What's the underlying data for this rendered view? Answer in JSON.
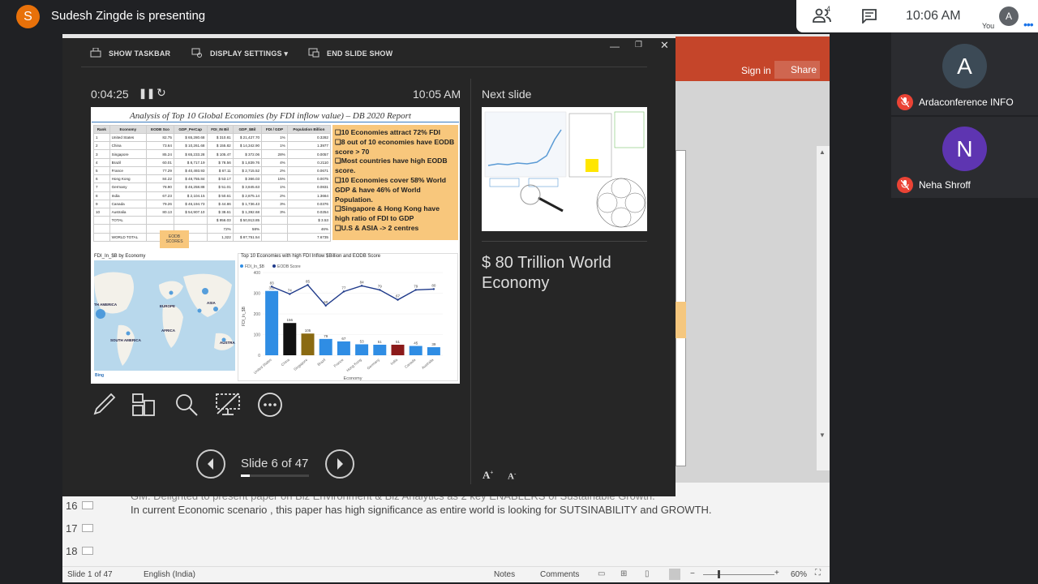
{
  "meet": {
    "presenter_initial": "S",
    "presenter_text": "Sudesh Zingde is presenting",
    "people_count": "4",
    "clock": "10:06 AM",
    "you_initial": "A",
    "you_label": "You",
    "participants": [
      {
        "initial": "A",
        "name": "Ardaconference INFO",
        "color": "#3c4a56"
      },
      {
        "initial": "N",
        "name": "Neha Shroff",
        "color": "#5e35b1"
      }
    ]
  },
  "ppt": {
    "sign_in": "Sign in",
    "share": "Share",
    "thumbs": [
      "16",
      "17",
      "18"
    ],
    "notes_line1": "GM. Delighted to present paper on Biz Environment & Biz Analytics as 2 key ENABLERS of Sustainable Growth.",
    "notes_line2": "In current Economic scenario , this paper has high significance as entire world is looking for SUTSINABILITY and GROWTH.",
    "status": {
      "slide": "Slide 1 of 47",
      "language": "English (India)",
      "notes": "Notes",
      "comments": "Comments",
      "zoom": "60%"
    }
  },
  "presenter_view": {
    "menu": {
      "taskbar": "SHOW TASKBAR",
      "display": "DISPLAY SETTINGS ▾",
      "end": "END SLIDE SHOW"
    },
    "timer": "0:04:25",
    "time": "10:05 AM",
    "next_slide_label": "Next slide",
    "slide_counter": "Slide 6 of 47",
    "progress": 0.128,
    "notes": "$ 80 Trillion World Economy"
  },
  "slide": {
    "title": "Analysis of Top 10 Global Economies (by FDI inflow value) – DB 2020 Report",
    "table_headers": [
      "Rank",
      "Economy",
      "EODB Sco",
      "GDP_PerCap",
      "FDI_IN Bil",
      "GDP_$Bil",
      "FDI / GDP",
      "Population Billion"
    ],
    "rows": [
      [
        "1",
        "United States",
        "82.75",
        "$ 65,280.68",
        "$ 310.81",
        "$ 21,427.70",
        "1%",
        "0.3282"
      ],
      [
        "2",
        "China",
        "73.64",
        "$ 10,261.68",
        "$ 155.82",
        "$ 14,342.90",
        "1%",
        "1.3977"
      ],
      [
        "3",
        "Singapore",
        "85.24",
        "$ 65,233.28",
        "$ 105.47",
        "$ 372.06",
        "28%",
        "0.0057"
      ],
      [
        "4",
        "Brazil",
        "60.01",
        "$ 8,717.19",
        "$ 78.56",
        "$ 1,839.76",
        "4%",
        "0.2110"
      ],
      [
        "5",
        "France",
        "77.29",
        "$ 40,493.93",
        "$ 67.11",
        "$ 2,715.52",
        "2%",
        "0.0671"
      ],
      [
        "6",
        "Hong Kong",
        "84.22",
        "$ 48,755.84",
        "$ 53.17",
        "$ 366.03",
        "15%",
        "0.0075"
      ],
      [
        "7",
        "Germany",
        "78.90",
        "$ 46,258.88",
        "$ 51.01",
        "$ 3,845.63",
        "1%",
        "0.0831"
      ],
      [
        "8",
        "India",
        "67.23",
        "$ 2,104.15",
        "$ 50.61",
        "$ 2,875.14",
        "2%",
        "1.3664"
      ],
      [
        "9",
        "Canada",
        "79.26",
        "$ 46,194.73",
        "$ 44.86",
        "$ 1,736.43",
        "3%",
        "0.0376"
      ],
      [
        "10",
        "Australia",
        "80.13",
        "$ 54,907.10",
        "$ 38.61",
        "$ 1,392.68",
        "3%",
        "0.0254"
      ]
    ],
    "total_row": [
      "",
      "TOTAL",
      "",
      "",
      "$ 956.03",
      "$ 50,913.85",
      "",
      "$ 3.53"
    ],
    "pct_row": [
      "",
      "",
      "",
      "",
      "72%",
      "58%",
      "",
      "46%"
    ],
    "world_row": [
      "",
      "WORLD TOTAL",
      "",
      "",
      "1,322",
      "$ 87,751.54",
      "",
      "7.6735"
    ],
    "eodb_tag": "EODB SCORES",
    "bullets": [
      "❑10 Economies attract 72% FDI",
      "❑8 out of 10 economies have EODB score > 70",
      "❑Most countries have high EODB score.",
      "❑10 Economies cover 58% World GDP & have 46% of World Population.",
      "❑Singapore & Hong Kong have high ratio of FDI to GDP",
      "❑U.S & ASIA -> 2 centres"
    ],
    "map_title": "FDI_In_$B by Economy",
    "map_labels": [
      "TH AMERICA",
      "EUROPE",
      "ASIA",
      "AFRICA",
      "SOUTH AMERICA",
      "AUSTRA"
    ],
    "map_credit": "Bing",
    "chart_title": "Top 10 Economies with high FDI Inflow $Billion and EODB Score",
    "chart_legend": [
      "FDI_In_$B",
      "EODB Score"
    ],
    "chart_xlabel": "Economy",
    "chart_ylabel": "FDI_In_$B"
  },
  "chart_data": {
    "type": "bar",
    "title": "Top 10 Economies with high FDI Inflow $Billion and EODB Score",
    "categories": [
      "United States",
      "China",
      "Singapore",
      "Brazil",
      "France",
      "Hong Kong",
      "Germany",
      "India",
      "Canada",
      "Australia"
    ],
    "series": [
      {
        "name": "FDI_In_$B",
        "values": [
          311,
          156,
          105,
          79,
          67,
          53,
          51,
          51,
          45,
          39
        ]
      },
      {
        "name": "EODB Score",
        "values": [
          83,
          74,
          85,
          60,
          77,
          84,
          79,
          67,
          79,
          80
        ]
      }
    ],
    "xlabel": "Economy",
    "ylabel": "FDI_In_$B",
    "ylim": [
      0,
      400
    ],
    "yticks": [
      "0",
      "100",
      "200",
      "300",
      "400"
    ],
    "bar_colors": [
      "#2f8de4",
      "#111111",
      "#8a6a12",
      "#2f8de4",
      "#2f8de4",
      "#2f8de4",
      "#2f8de4",
      "#8b1a1a",
      "#2f8de4",
      "#2f8de4"
    ],
    "line_color": "#1f3a8a"
  }
}
